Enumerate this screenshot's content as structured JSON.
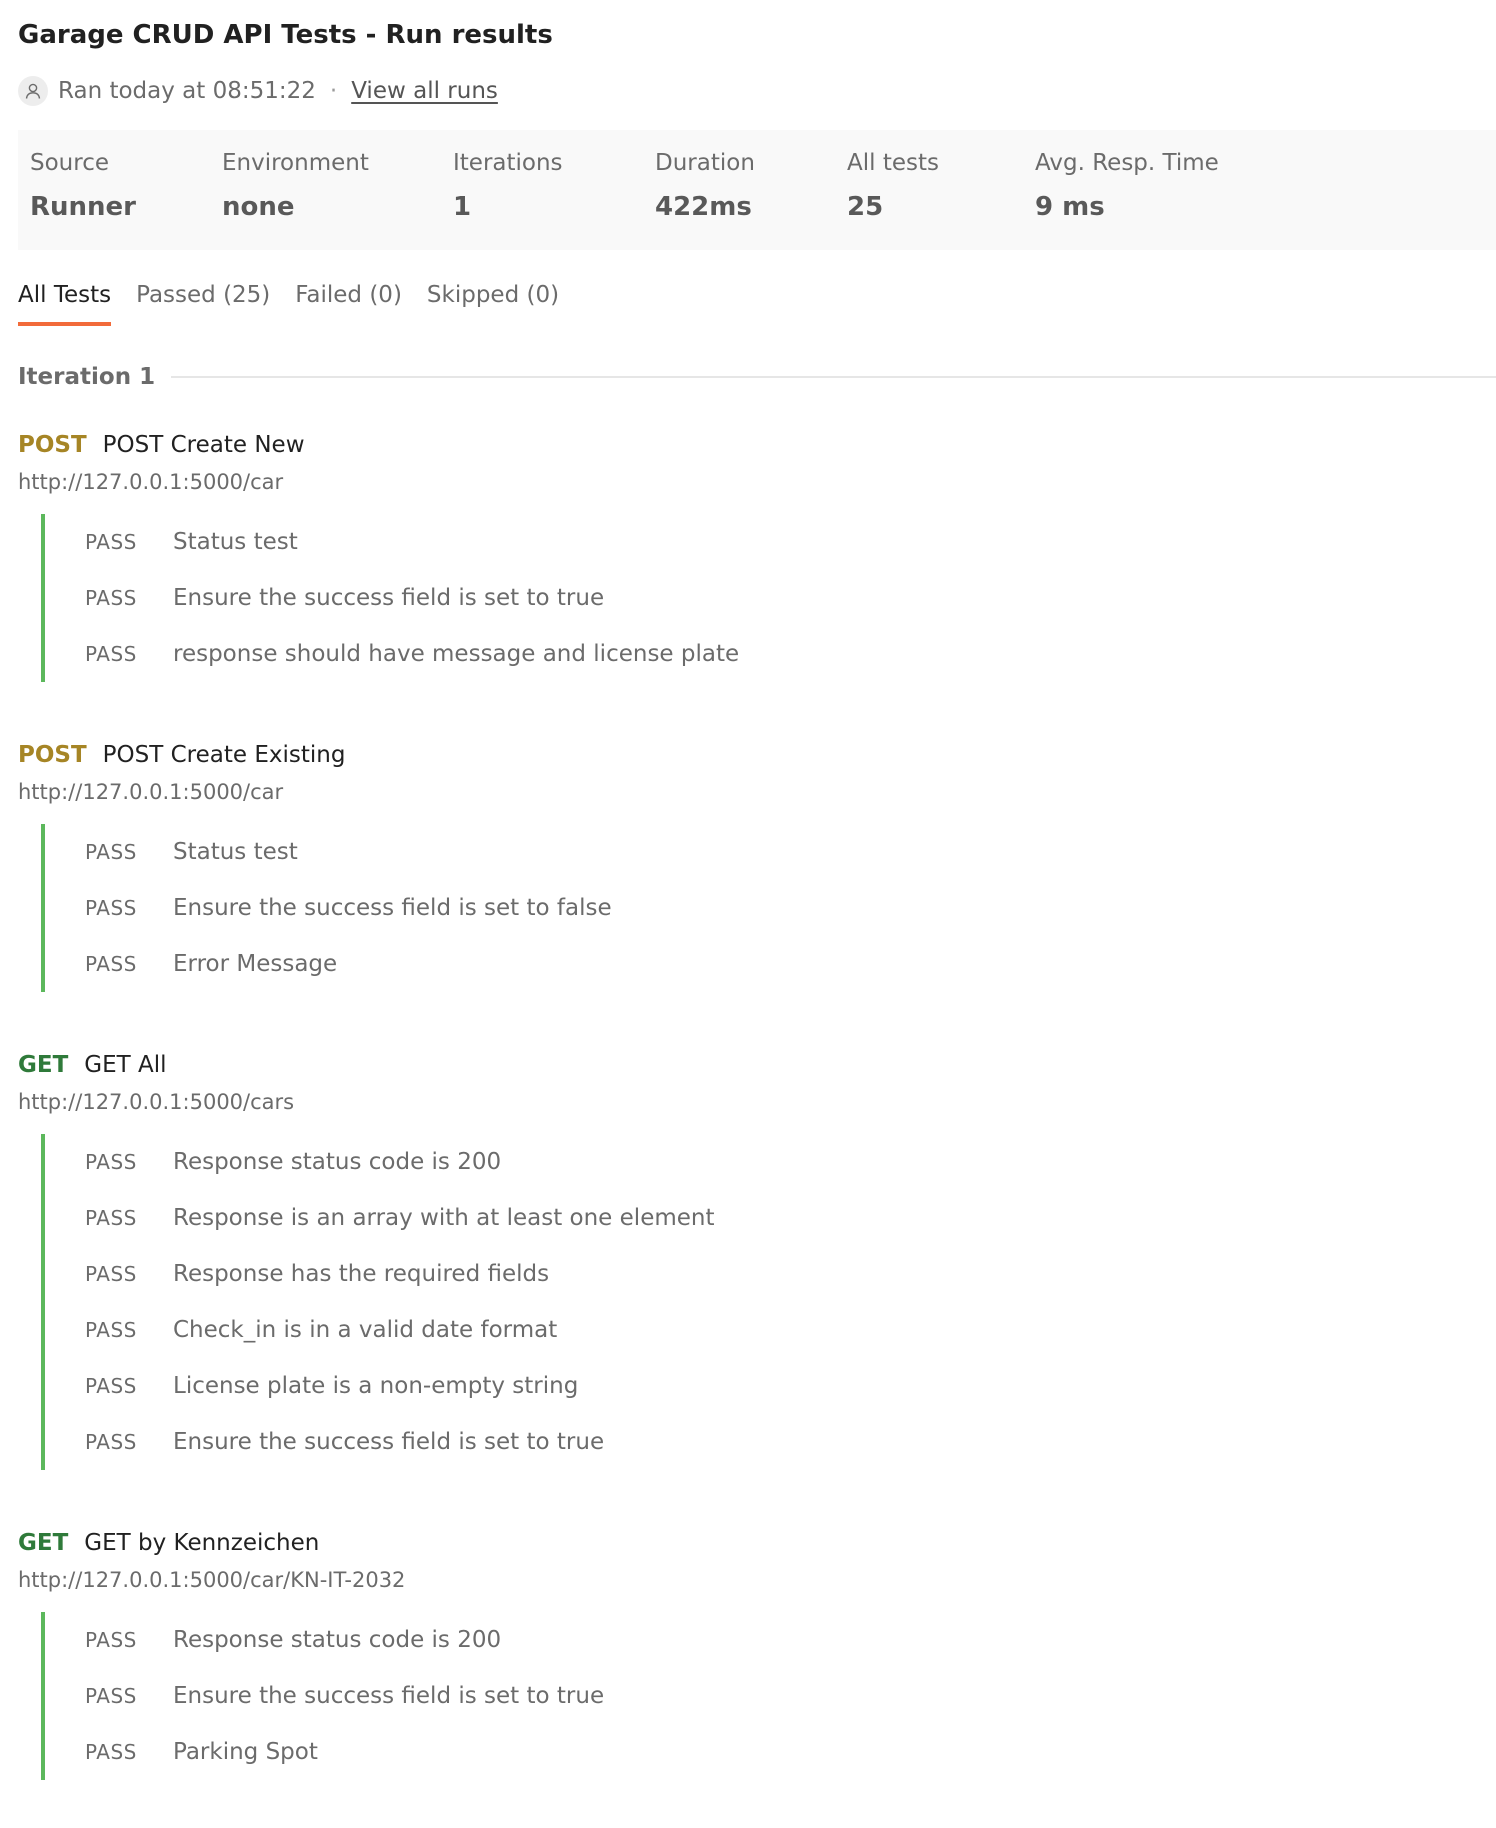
{
  "header": {
    "title": "Garage CRUD API Tests - Run results",
    "ran_text": "Ran today at 08:51:22",
    "separator": "·",
    "view_all_runs": "View all runs",
    "user_icon": "user-icon"
  },
  "summary": [
    {
      "label": "Source",
      "value": "Runner"
    },
    {
      "label": "Environment",
      "value": "none"
    },
    {
      "label": "Iterations",
      "value": "1"
    },
    {
      "label": "Duration",
      "value": "422ms"
    },
    {
      "label": "All tests",
      "value": "25"
    },
    {
      "label": "Avg. Resp. Time",
      "value": "9 ms"
    }
  ],
  "tabs": [
    {
      "label": "All Tests",
      "active": true
    },
    {
      "label": "Passed (25)",
      "active": false
    },
    {
      "label": "Failed (0)",
      "active": false
    },
    {
      "label": "Skipped (0)",
      "active": false
    }
  ],
  "iteration_label": "Iteration 1",
  "colors": {
    "post": "#a68525",
    "get": "#2f7a3a",
    "pass_bar": "#5cb85c",
    "active_tab": "#f26b3a"
  },
  "requests": [
    {
      "method": "POST",
      "name": "POST Create New",
      "url": "http://127.0.0.1:5000/car",
      "tests": [
        {
          "status": "PASS",
          "name": "Status test"
        },
        {
          "status": "PASS",
          "name": "Ensure the success field is set to true"
        },
        {
          "status": "PASS",
          "name": "response should have message and license plate"
        }
      ]
    },
    {
      "method": "POST",
      "name": "POST Create Existing",
      "url": "http://127.0.0.1:5000/car",
      "tests": [
        {
          "status": "PASS",
          "name": "Status test"
        },
        {
          "status": "PASS",
          "name": "Ensure the success field is set to false"
        },
        {
          "status": "PASS",
          "name": "Error Message"
        }
      ]
    },
    {
      "method": "GET",
      "name": "GET All",
      "url": "http://127.0.0.1:5000/cars",
      "tests": [
        {
          "status": "PASS",
          "name": "Response status code is 200"
        },
        {
          "status": "PASS",
          "name": "Response is an array with at least one element"
        },
        {
          "status": "PASS",
          "name": "Response has the required fields"
        },
        {
          "status": "PASS",
          "name": "Check_in is in a valid date format"
        },
        {
          "status": "PASS",
          "name": "License plate is a non-empty string"
        },
        {
          "status": "PASS",
          "name": "Ensure the success field is set to true"
        }
      ]
    },
    {
      "method": "GET",
      "name": "GET by Kennzeichen",
      "url": "http://127.0.0.1:5000/car/KN-IT-2032",
      "tests": [
        {
          "status": "PASS",
          "name": "Response status code is 200"
        },
        {
          "status": "PASS",
          "name": "Ensure the success field is set to true"
        },
        {
          "status": "PASS",
          "name": "Parking Spot"
        }
      ]
    }
  ]
}
